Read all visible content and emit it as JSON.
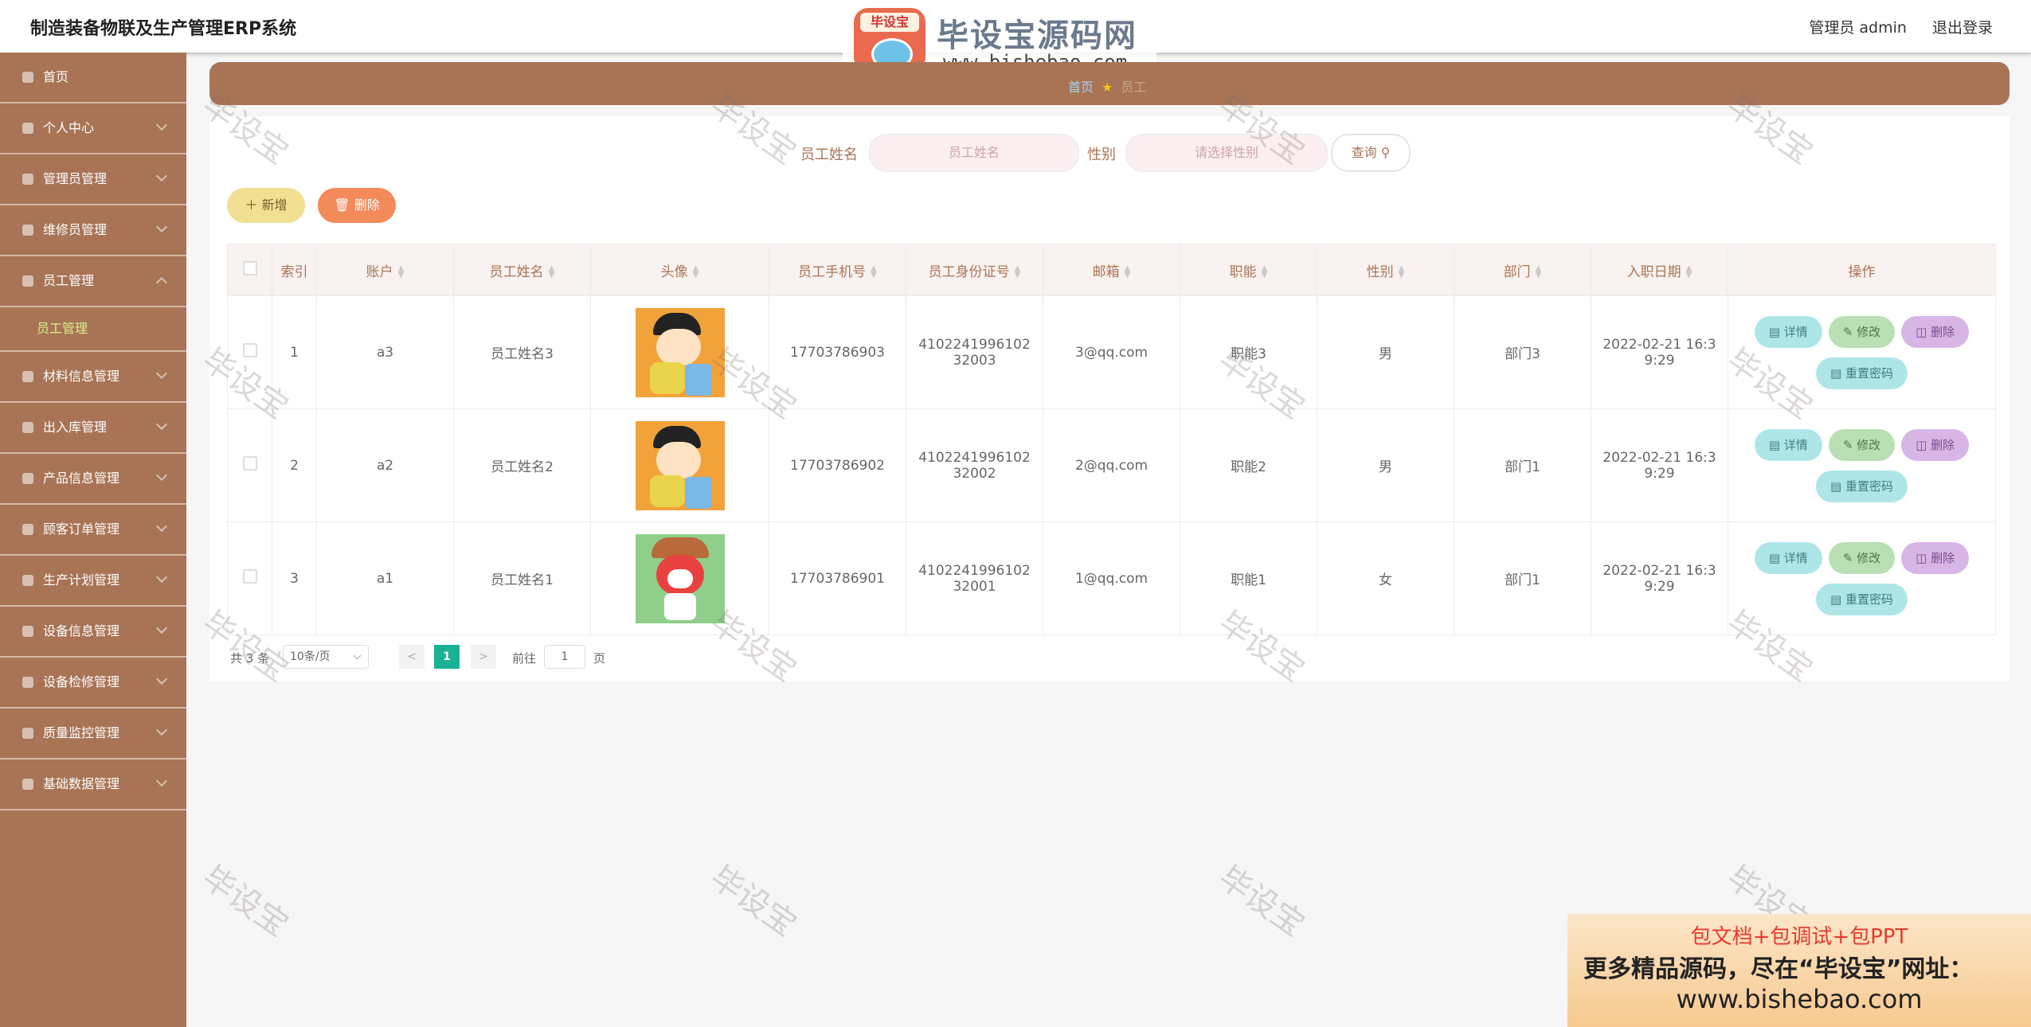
{
  "header": {
    "title": "制造装备物联及生产管理ERP系统",
    "user_label": "管理员 admin",
    "logout_label": "退出登录"
  },
  "logo": {
    "badge": "毕设宝",
    "name": "毕设宝源码网",
    "url": "www.bishebao.com"
  },
  "sidebar": {
    "items": [
      {
        "label": "首页",
        "icon": "home-icon"
      },
      {
        "label": "个人中心",
        "icon": "user-icon"
      },
      {
        "label": "管理员管理",
        "icon": "microphone-icon"
      },
      {
        "label": "维修员管理",
        "icon": "clock-icon"
      },
      {
        "label": "员工管理",
        "icon": "bank-icon"
      },
      {
        "label": "材料信息管理",
        "icon": "box-icon"
      },
      {
        "label": "出入库管理",
        "icon": "bar-chart-icon"
      },
      {
        "label": "产品信息管理",
        "icon": "mail-icon"
      },
      {
        "label": "顾客订单管理",
        "icon": "monitor-icon"
      },
      {
        "label": "生产计划管理",
        "icon": "list-icon"
      },
      {
        "label": "设备信息管理",
        "icon": "grid-icon"
      },
      {
        "label": "设备检修管理",
        "icon": "list-icon"
      },
      {
        "label": "质量监控管理",
        "icon": "shield-icon"
      },
      {
        "label": "基础数据管理",
        "icon": "gear-icon"
      }
    ],
    "subitem": "员工管理"
  },
  "breadcrumb": {
    "home": "首页",
    "current": "员工"
  },
  "search": {
    "name_label": "员工姓名",
    "name_placeholder": "员工姓名",
    "gender_label": "性别",
    "gender_placeholder": "请选择性别",
    "query_label": "查询"
  },
  "actions": {
    "add_label": "新增",
    "delete_label": "删除"
  },
  "table": {
    "columns": [
      "索引",
      "账户",
      "员工姓名",
      "头像",
      "员工手机号",
      "员工身份证号",
      "邮箱",
      "职能",
      "性别",
      "部门",
      "入职日期",
      "操作"
    ],
    "rows": [
      {
        "index": "1",
        "account": "a3",
        "name": "员工姓名3",
        "phone": "17703786903",
        "idcard": "410224199610232003",
        "email": "3@qq.com",
        "role": "职能3",
        "gender": "男",
        "dept": "部门3",
        "date": "2022-02-21 16:39:29"
      },
      {
        "index": "2",
        "account": "a2",
        "name": "员工姓名2",
        "phone": "17703786902",
        "idcard": "410224199610232002",
        "email": "2@qq.com",
        "role": "职能2",
        "gender": "男",
        "dept": "部门1",
        "date": "2022-02-21 16:39:29"
      },
      {
        "index": "3",
        "account": "a1",
        "name": "员工姓名1",
        "phone": "17703786901",
        "idcard": "410224199610232001",
        "email": "1@qq.com",
        "role": "职能1",
        "gender": "女",
        "dept": "部门1",
        "date": "2022-02-21 16:39:29"
      }
    ],
    "op_detail": "详情",
    "op_edit": "修改",
    "op_delete": "删除",
    "op_reset": "重置密码"
  },
  "pager": {
    "total": "共 3 条",
    "page_size": "10条/页",
    "prev": "<",
    "current": "1",
    "next": ">",
    "goto_label": "前往",
    "goto_value": "1",
    "goto_unit": "页"
  },
  "watermark": "毕设宝",
  "promo": {
    "line1": "包文档+包调试+包PPT",
    "line2": "更多精品源码，尽在“毕设宝”网址：",
    "line3": "www.bishebao.com"
  }
}
